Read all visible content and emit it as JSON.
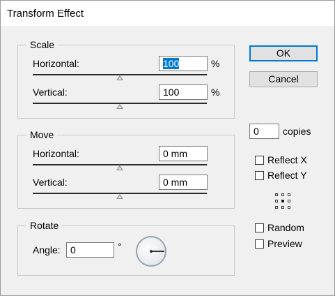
{
  "window": {
    "title": "Transform Effect"
  },
  "scale": {
    "legend": "Scale",
    "horizontal_label": "Horizontal:",
    "horizontal_value": "100",
    "horizontal_unit": "%",
    "vertical_label": "Vertical:",
    "vertical_value": "100",
    "vertical_unit": "%"
  },
  "move": {
    "legend": "Move",
    "horizontal_label": "Horizontal:",
    "horizontal_value": "0 mm",
    "vertical_label": "Vertical:",
    "vertical_value": "0 mm"
  },
  "rotate": {
    "legend": "Rotate",
    "angle_label": "Angle:",
    "angle_value": "0",
    "angle_unit": "°"
  },
  "buttons": {
    "ok": "OK",
    "cancel": "Cancel"
  },
  "copies": {
    "value": "0",
    "label": "copies"
  },
  "options": {
    "reflect_x": {
      "label": "Reflect X",
      "checked": false
    },
    "reflect_y": {
      "label": "Reflect Y",
      "checked": false
    },
    "random": {
      "label": "Random",
      "checked": false
    },
    "preview": {
      "label": "Preview",
      "checked": false
    }
  },
  "colors": {
    "accent": "#0078d7",
    "button_bg": "#e1e1e1",
    "dialog_bg": "#f0f0f0"
  }
}
